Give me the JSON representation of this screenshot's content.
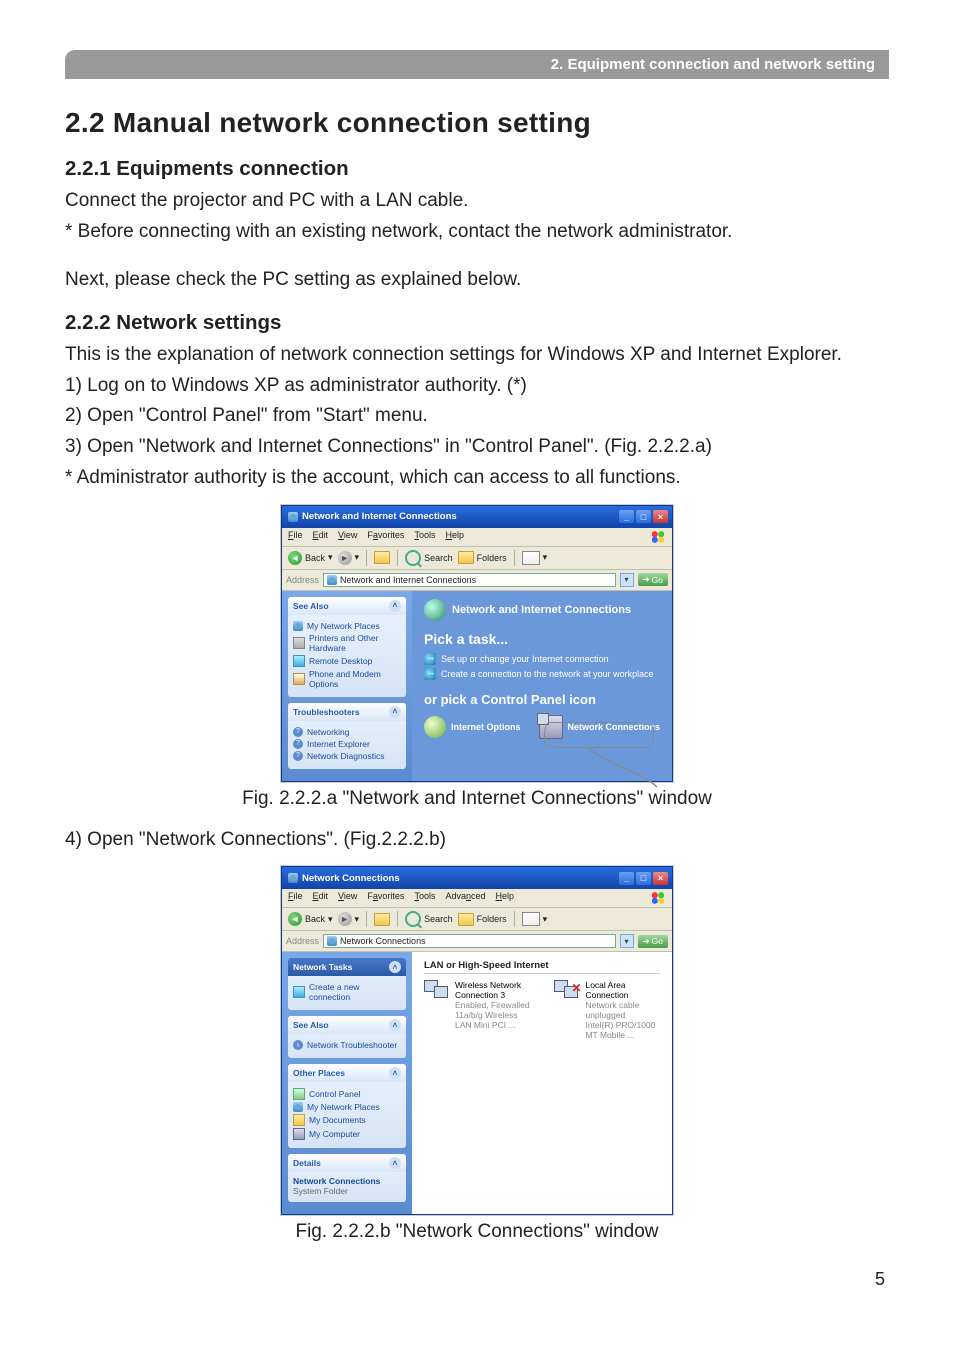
{
  "header_bar": "2. Equipment connection and network setting",
  "section_title": "2.2 Manual network connection setting",
  "sub1_title": "2.2.1 Equipments connection",
  "sub1_p1": "Connect the projector and PC with a LAN cable.",
  "sub1_p2": "* Before connecting with an existing network, contact the network administrator.",
  "sub1_p3": "Next, please check the PC setting as explained below.",
  "sub2_title": "2.2.2 Network settings",
  "sub2_p1": "This is the explanation of network connection settings for Windows XP and Internet Explorer.",
  "sub2_l1": "1) Log on to Windows XP as administrator authority. (*)",
  "sub2_l2": "2) Open \"Control Panel\" from \"Start\" menu.",
  "sub2_l3": "3) Open \"Network and Internet Connections\" in \"Control Panel\". (Fig. 2.2.2.a)",
  "sub2_l4": "* Administrator authority is the account, which can access to all functions.",
  "fig_a_caption": "Fig. 2.2.2.a \"Network and Internet Connections\" window",
  "sub2_l5": "4) Open \"Network Connections\". (Fig.2.2.2.b)",
  "fig_b_caption": "Fig. 2.2.2.b \"Network Connections\" window",
  "page_number": "5",
  "winA": {
    "title": "Network and Internet Connections",
    "menu": {
      "file": "File",
      "edit": "Edit",
      "view": "View",
      "fav": "Favorites",
      "tools": "Tools",
      "help": "Help"
    },
    "toolbar": {
      "back": "Back",
      "search": "Search",
      "folders": "Folders"
    },
    "address_label": "Address",
    "address_value": "Network and Internet Connections",
    "go": "Go",
    "side": {
      "seealso": {
        "title": "See Also",
        "items": [
          "My Network Places",
          "Printers and Other Hardware",
          "Remote Desktop",
          "Phone and Modem Options"
        ]
      },
      "troubleshoot": {
        "title": "Troubleshooters",
        "items": [
          "Networking",
          "Internet Explorer",
          "Network Diagnostics"
        ]
      }
    },
    "main": {
      "heading": "Network and Internet Connections",
      "pick_task": "Pick a task...",
      "task1": "Set up or change your Internet connection",
      "task2": "Create a connection to the network at your workplace",
      "or_pick": "or pick a Control Panel icon",
      "cp1": "Internet Options",
      "cp2": "Network Connections"
    }
  },
  "winB": {
    "title": "Network Connections",
    "menu": {
      "file": "File",
      "edit": "Edit",
      "view": "View",
      "fav": "Favorites",
      "tools": "Tools",
      "adv": "Advanced",
      "help": "Help"
    },
    "toolbar": {
      "back": "Back",
      "search": "Search",
      "folders": "Folders"
    },
    "address_label": "Address",
    "address_value": "Network Connections",
    "go": "Go",
    "side": {
      "tasks": {
        "title": "Network Tasks",
        "items": [
          "Create a new connection"
        ]
      },
      "seealso": {
        "title": "See Also",
        "items": [
          "Network Troubleshooter"
        ]
      },
      "other": {
        "title": "Other Places",
        "items": [
          "Control Panel",
          "My Network Places",
          "My Documents",
          "My Computer"
        ]
      },
      "details": {
        "title": "Details",
        "line1": "Network Connections",
        "line2": "System Folder"
      }
    },
    "main": {
      "category": "LAN or High-Speed Internet",
      "conn1": {
        "name": "Wireless Network Connection 3",
        "status": "Enabled, Firewalled",
        "device": "11a/b/g Wireless LAN Mini PCI ..."
      },
      "conn2": {
        "name": "Local Area Connection",
        "status": "Network cable unplugged",
        "device": "Intel(R) PRO/1000 MT Mobile ..."
      }
    }
  }
}
